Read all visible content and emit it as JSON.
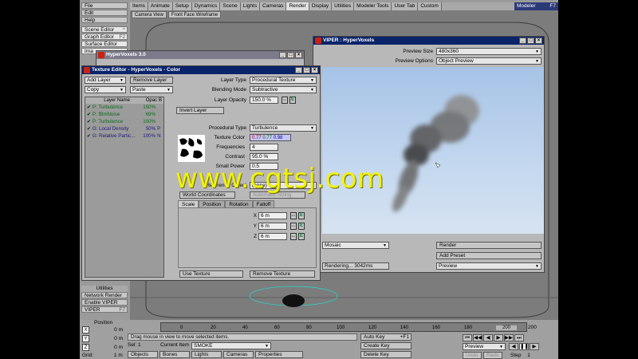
{
  "left_menu": [
    {
      "label": "File",
      "key": ""
    },
    {
      "label": "Edit",
      "key": ""
    },
    {
      "label": "Help",
      "key": ""
    }
  ],
  "edit_menu": [
    {
      "label": "Scene Editor",
      "key": "^"
    },
    {
      "label": "Graph Editor",
      "key": "F2"
    },
    {
      "label": "Surface Editor",
      "key": ""
    },
    {
      "label": "Ima",
      "key": ""
    }
  ],
  "tabs": [
    "Items",
    "Animate",
    "Setup",
    "Dynamics",
    "Scene",
    "Lights",
    "Cameras",
    "Render",
    "Display",
    "Utilities",
    "Modeler Tools",
    "User Tab",
    "Custom"
  ],
  "active_tab": "Render",
  "modeler": {
    "label": "Modeler",
    "key": "F7"
  },
  "viewport": {
    "view": "Camera View",
    "shading": "Front Face Wireframe"
  },
  "hypervoxels_window": {
    "title": "HyperVoxels 3.0"
  },
  "texture_editor": {
    "title": "Texture Editor - HyperVoxels - Color",
    "add_layer": "Add Layer",
    "remove_layer": "Remove Layer",
    "copy": "Copy",
    "paste": "Paste",
    "columns": {
      "name": "Layer Name",
      "opacity": "Opac",
      "blend": "B"
    },
    "layers": [
      {
        "name": "P: Turbulence",
        "opacity": "150%",
        "blend": "",
        "color": "#0b6a1b"
      },
      {
        "name": "P: fBmNoise",
        "opacity": "69%",
        "blend": "",
        "color": "#0b6a1b"
      },
      {
        "name": "P: Turbulence",
        "opacity": "100%",
        "blend": "",
        "color": "#0b6a1b"
      },
      {
        "name": "G: Local Density",
        "opacity": "50%",
        "blend": "P",
        "color": "#1a1a7a"
      },
      {
        "name": "G: Relative Partic...",
        "opacity": "100%",
        "blend": "N",
        "color": "#1a1a7a"
      }
    ],
    "layer_type_label": "Layer Type",
    "layer_type": "Procedural Texture",
    "blending_mode_label": "Blending Mode",
    "blending_mode": "Subtractive",
    "layer_opacity_label": "Layer Opacity",
    "layer_opacity": "150.0 %",
    "invert_layer": "Invert Layer",
    "procedural_type_label": "Procedural Type",
    "procedural_type": "Turbulence",
    "texture_color_label": "Texture Color",
    "texture_color": {
      "r": "0.77",
      "g": "0.77",
      "b": "0.98"
    },
    "frequencies_label": "Frequencies",
    "frequencies": "4",
    "contrast_label": "Contrast",
    "contrast": "95.0 %",
    "small_power_label": "Small Power",
    "small_power": "0.5",
    "reference_object_label": "Reference Object",
    "reference_object": "(none)",
    "world_coordinates": "World Coordinates",
    "automatic_sizing": "Automatic Sizing",
    "subtabs": [
      "Scale",
      "Position",
      "Rotation",
      "Falloff"
    ],
    "axes": [
      {
        "axis": "X",
        "value": "6 m"
      },
      {
        "axis": "Y",
        "value": "6 m"
      },
      {
        "axis": "Z",
        "value": "6 m"
      }
    ],
    "use_texture": "Use Texture",
    "remove_texture": "Remove Texture"
  },
  "viper": {
    "title": "VIPER : HyperVoxels",
    "preview_size_label": "Preview Size",
    "preview_size": "480x360",
    "preview_options_label": "Preview Options",
    "preview_options": "Object Preview",
    "mode": "Mosaic",
    "status": "Rendering... 3042ms",
    "render": "Render",
    "add_preset": "Add Preset",
    "preview": "Preview"
  },
  "utilities": {
    "header": "Utilities",
    "items": [
      {
        "label": "Network Render",
        "key": ""
      },
      {
        "label": "Enable VIPER",
        "key": ""
      },
      {
        "label": "VIPER",
        "key": "F7"
      }
    ]
  },
  "bottom": {
    "position_label": "Position",
    "coords": [
      {
        "axis": "X",
        "value": "0 m"
      },
      {
        "axis": "Y",
        "value": "0 m"
      },
      {
        "axis": "Z",
        "value": "0 m"
      }
    ],
    "grid_label": "Grid:",
    "grid_value": "1 m",
    "ticks": [
      "0",
      "20",
      "40",
      "60",
      "80",
      "100",
      "120",
      "140",
      "160",
      "180",
      "200"
    ],
    "end_frame": "200",
    "current_frame": "0",
    "status": "Drag mouse in view to move selected items.",
    "sel_label": "Sel:",
    "sel_value": "1",
    "current_item_label": "Current Item",
    "current_item": "SMOKE",
    "filters": [
      "Objects",
      "Bones",
      "Lights",
      "Cameras",
      "Properties"
    ],
    "auto_key": "Auto Key",
    "auto_key_hint": "+F1",
    "create_key": "Create Key",
    "delete_key": "Delete Key",
    "preview": "Preview",
    "undo": "Undo",
    "redo": "Redo",
    "step_label": "Step",
    "step": "1"
  },
  "watermark": "www.cgtsj.com"
}
